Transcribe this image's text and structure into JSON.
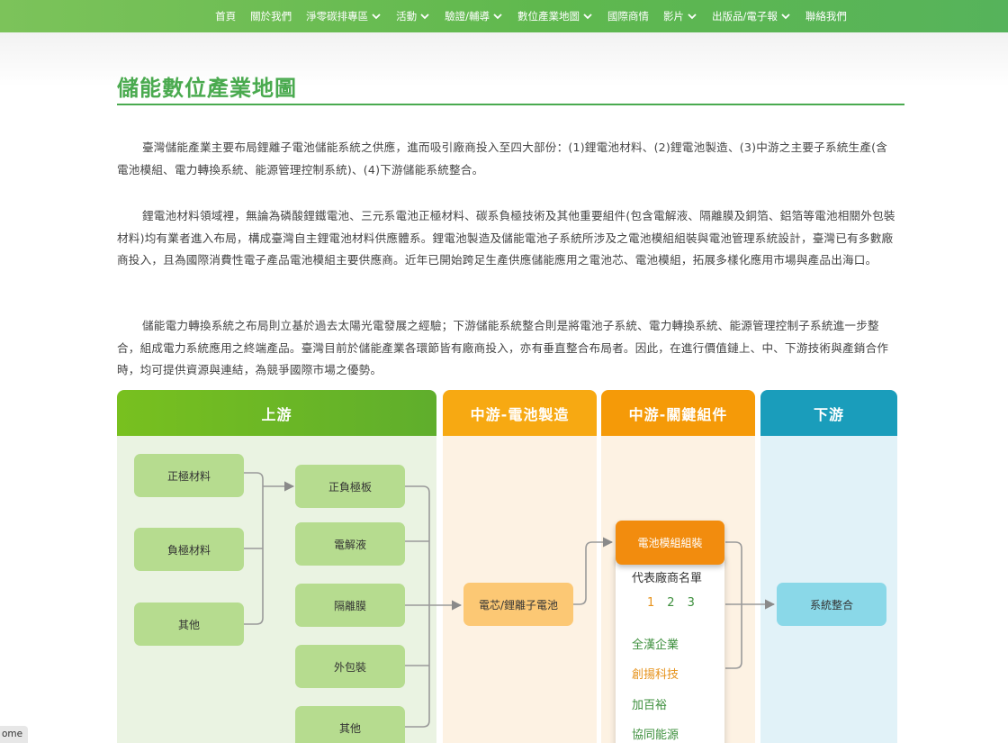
{
  "nav": {
    "items": [
      {
        "label": "首頁",
        "dropdown": false
      },
      {
        "label": "關於我們",
        "dropdown": false
      },
      {
        "label": "淨零碳排專區",
        "dropdown": true
      },
      {
        "label": "活動",
        "dropdown": true
      },
      {
        "label": "驗證/輔導",
        "dropdown": true
      },
      {
        "label": "數位產業地圖",
        "dropdown": true
      },
      {
        "label": "國際商情",
        "dropdown": false
      },
      {
        "label": "影片",
        "dropdown": true
      },
      {
        "label": "出版品/電子報",
        "dropdown": true
      },
      {
        "label": "聯絡我們",
        "dropdown": false
      }
    ]
  },
  "page": {
    "title": "儲能數位產業地圖",
    "paragraphs": [
      "臺灣儲能產業主要布局鋰離子電池儲能系統之供應，進而吸引廠商投入至四大部份：(1)鋰電池材料、(2)鋰電池製造、(3)中游之主要子系統生產(含電池模組、電力轉換系統、能源管理控制系統)、(4)下游儲能系統整合。",
      "鋰電池材料領域裡，無論為磷酸鋰鐵電池、三元系電池正極材料、碳系負極技術及其他重要組件(包含電解液、隔離膜及銅箔、鋁箔等電池相關外包裝材料)均有業者進入布局，構成臺灣自主鋰電池材料供應體系。鋰電池製造及儲能電池子系統所涉及之電池模組組裝與電池管理系統設計，臺灣已有多數廠商投入，且為國際消費性電子產品電池模組主要供應商。近年已開始跨足生產供應儲能應用之電池芯、電池模組，拓展多樣化應用市場與產品出海口。",
      "儲能電力轉換系統之布局則立基於過去太陽光電發展之經驗；下游儲能系統整合則是將電池子系統、電力轉換系統、能源管理控制子系統進一步整合，組成電力系統應用之終端產品。臺灣目前於儲能產業各環節皆有廠商投入，亦有垂直整合布局者。因此，在進行價值鏈上、中、下游技術與產銷合作時，均可提供資源與連結，為競爭國際市場之優勢。"
    ]
  },
  "diagram": {
    "columns": [
      {
        "title": "上游",
        "color": "#6ab526"
      },
      {
        "title": "中游-電池製造",
        "color": "#f7a912"
      },
      {
        "title": "中游-關鍵組件",
        "color": "#f59a08"
      },
      {
        "title": "下游",
        "color": "#1a9dbb"
      }
    ],
    "upstream_left": [
      "正極材料",
      "負極材料",
      "其他"
    ],
    "upstream_right": [
      "正負極板",
      "電解液",
      "隔離膜",
      "外包裝",
      "其他"
    ],
    "midstream_cell": "電芯/鋰離子電池",
    "midstream_module": "電池模組組裝",
    "vendor_card": {
      "title": "代表廠商名單",
      "pages": [
        "1",
        "2",
        "3"
      ],
      "current_page": "1",
      "vendors": [
        {
          "name": "全漢企業",
          "color": "#3d8f3d"
        },
        {
          "name": "創揚科技",
          "color": "#e6921a"
        },
        {
          "name": "加百裕",
          "color": "#3d8f3d"
        },
        {
          "name": "協同能源",
          "color": "#3d8f3d"
        }
      ]
    },
    "downstream": "系統整合"
  },
  "corner_tab": "ome"
}
